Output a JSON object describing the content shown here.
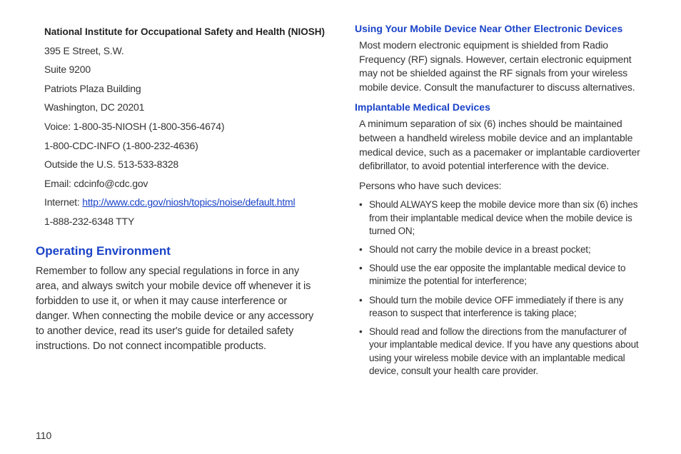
{
  "left": {
    "niosh": {
      "title": "National Institute for Occupational Safety and Health (NIOSH)",
      "line1": "395 E Street, S.W.",
      "line2": "Suite 9200",
      "line3": "Patriots Plaza Building",
      "line4": "Washington, DC 20201",
      "voice": "Voice: 1-800-35-NIOSH (1-800-356-4674)",
      "cdcinfo": "1-800-CDC-INFO (1-800-232-4636)",
      "outside": "Outside the U.S. 513-533-8328",
      "email": "Email: cdcinfo@cdc.gov",
      "internet_prefix": "Internet: ",
      "internet_url": "http://www.cdc.gov/niosh/topics/noise/default.html",
      "tty": "1-888-232-6348 TTY"
    },
    "operating": {
      "head": "Operating Environment",
      "body": "Remember to follow any special regulations in force in any area, and always switch your mobile device off whenever it is forbidden to use it, or when it may cause interference or danger. When connecting the mobile device or any accessory to another device, read its user's guide for detailed safety instructions. Do not connect incompatible products."
    }
  },
  "right": {
    "near_devices": {
      "head": "Using Your Mobile Device Near Other Electronic Devices",
      "body": "Most modern electronic equipment is shielded from Radio Frequency (RF) signals. However, certain electronic equipment may not be shielded against the RF signals from your wireless mobile device. Consult the manufacturer to discuss alternatives."
    },
    "implant": {
      "head": "Implantable Medical Devices",
      "body1": "A minimum separation of six (6) inches should be maintained between a handheld wireless mobile device and an implantable medical device, such as a pacemaker or implantable cardioverter defibrillator, to avoid potential interference with the device.",
      "body2": "Persons who have such devices:",
      "bullets": [
        "Should ALWAYS keep the mobile device more than six (6) inches from their implantable medical device when the mobile device is turned ON;",
        "Should not carry the mobile device in a breast pocket;",
        "Should use the ear opposite the implantable medical device to minimize the potential for interference;",
        "Should turn the mobile device OFF immediately if there is any reason to suspect that interference is taking place;",
        "Should read and follow the directions from the manufacturer of your implantable medical device. If you have any questions about using your wireless mobile device with an implantable medical device, consult your health care provider."
      ]
    }
  },
  "page_number": "110"
}
